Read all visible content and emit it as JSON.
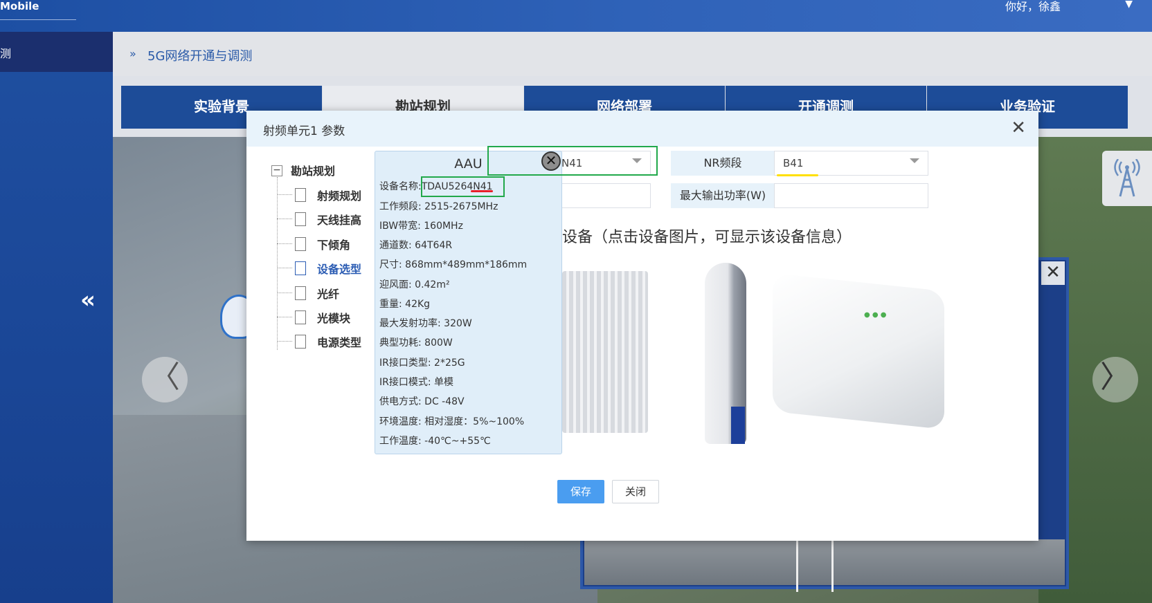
{
  "header": {
    "brand": "Mobile",
    "user_greeting": "你好，徐鑫",
    "user_menu_icon": "chevron-down-icon"
  },
  "sidebar": {
    "active_item": "测",
    "collapse_symbol": "«"
  },
  "breadcrumb": {
    "arrow": "»",
    "title": "5G网络开通与调测"
  },
  "tabs": [
    {
      "label": "实验背景"
    },
    {
      "label": "勘站规划"
    },
    {
      "label": "网络部署"
    },
    {
      "label": "开通调测"
    },
    {
      "label": "业务验证"
    }
  ],
  "scene": {
    "prev_symbol": "〈",
    "next_symbol": "〉",
    "panel_close": "✕"
  },
  "dialog": {
    "title": "射频单元1 参数",
    "close_symbol": "✕",
    "tree": {
      "root": "勘站规划",
      "items": [
        {
          "label": "射频规划"
        },
        {
          "label": "天线挂高"
        },
        {
          "label": "下倾角"
        },
        {
          "label": "设备选型"
        },
        {
          "label": "光纤"
        },
        {
          "label": "光模块"
        },
        {
          "label": "电源类型"
        }
      ]
    },
    "fields": {
      "device_select_value": "N41",
      "nr_band_label": "NR频段",
      "nr_band_value": "B41",
      "max_power_label": "最大输出功率(W)",
      "max_power_value": ""
    },
    "section_title": "设备（点击设备图片，可显示该设备信息）",
    "popup": {
      "title": "AAU",
      "close_symbol": "✕",
      "rows": [
        {
          "label": "设备名称:",
          "value": "TDAU5264N41"
        },
        {
          "label": "工作频段:",
          "value": "2515-2675MHz"
        },
        {
          "label": "IBW带宽:",
          "value": "160MHz"
        },
        {
          "label": "通道数:",
          "value": "64T64R"
        },
        {
          "label": "尺寸:",
          "value": "868mm*489mm*186mm"
        },
        {
          "label": "迎风面:",
          "value": "0.42m²"
        },
        {
          "label": "重量:",
          "value": "42Kg"
        },
        {
          "label": "最大发射功率:",
          "value": "320W"
        },
        {
          "label": "典型功耗:",
          "value": "800W"
        },
        {
          "label": "IR接口类型:",
          "value": "2*25G"
        },
        {
          "label": "IR接口模式:",
          "value": "单模"
        },
        {
          "label": "供电方式:",
          "value": "DC -48V"
        },
        {
          "label": "环境温度:",
          "value": "相对湿度：5%~100%"
        },
        {
          "label": "工作温度:",
          "value": "-40℃~+55℃"
        }
      ]
    },
    "buttons": {
      "save": "保存",
      "close": "关闭"
    }
  },
  "colors": {
    "accent_blue": "#2b5cb3",
    "tab_blue": "#1d4c98",
    "save_button": "#4a9df0",
    "highlight_green": "#21a84a",
    "highlight_red": "#e8202a",
    "highlight_yellow": "#ffe000"
  }
}
